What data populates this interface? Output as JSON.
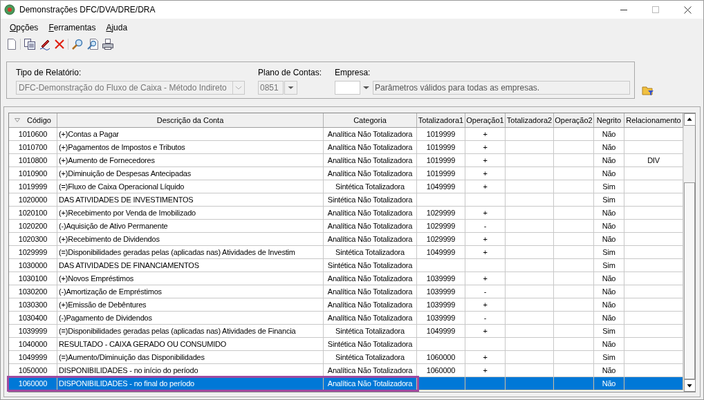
{
  "window": {
    "title": "Demonstrações DFC/DVA/DRE/DRA"
  },
  "menu": [
    "Opções",
    "Ferramentas",
    "Ajuda"
  ],
  "params": {
    "tipo": {
      "label": "Tipo de Relatório:",
      "value": "DFC-Demonstração do Fluxo de Caixa - Método Indireto",
      "disabled": true
    },
    "plano": {
      "label": "Plano de Contas:",
      "value": "0851",
      "disabled": true
    },
    "empresa": {
      "label": "Empresa:",
      "description": "Parâmetros válidos para todas as empresas."
    }
  },
  "table": {
    "columns": [
      "Código",
      "Descrição da Conta",
      "Categoria",
      "Totalizadora1",
      "Operação1",
      "Totalizadora2",
      "Operação2",
      "Negrito",
      "Relacionamento"
    ],
    "rows": [
      {
        "cells": [
          "1010600",
          "(+)Contas a Pagar",
          "Analítica Não Totalizadora",
          "1019999",
          "+",
          "",
          "",
          "Não",
          ""
        ],
        "selected": false
      },
      {
        "cells": [
          "1010700",
          "(+)Pagamentos de Impostos e Tributos",
          "Analítica Não Totalizadora",
          "1019999",
          "+",
          "",
          "",
          "Não",
          ""
        ],
        "selected": false
      },
      {
        "cells": [
          "1010800",
          "(+)Aumento de Fornecedores",
          "Analítica Não Totalizadora",
          "1019999",
          "+",
          "",
          "",
          "Não",
          "DIV"
        ],
        "selected": false
      },
      {
        "cells": [
          "1010900",
          "(+)Diminuição de Despesas Antecipadas",
          "Analítica Não Totalizadora",
          "1019999",
          "+",
          "",
          "",
          "Não",
          ""
        ],
        "selected": false
      },
      {
        "cells": [
          "1019999",
          "(=)Fluxo de Caixa Operacional Líquido",
          "Sintética Totalizadora",
          "1049999",
          "+",
          "",
          "",
          "Sim",
          ""
        ],
        "selected": false
      },
      {
        "cells": [
          "1020000",
          "DAS ATIVIDADES DE INVESTIMENTOS",
          "Sintética Não Totalizadora",
          "",
          "",
          "",
          "",
          "Sim",
          ""
        ],
        "selected": false
      },
      {
        "cells": [
          "1020100",
          "(+)Recebimento por Venda de Imobilizado",
          "Analítica Não Totalizadora",
          "1029999",
          "+",
          "",
          "",
          "Não",
          ""
        ],
        "selected": false
      },
      {
        "cells": [
          "1020200",
          "(-)Aquisição de Ativo Permanente",
          "Analítica Não Totalizadora",
          "1029999",
          "-",
          "",
          "",
          "Não",
          ""
        ],
        "selected": false
      },
      {
        "cells": [
          "1020300",
          "(+)Recebimento de Dividendos",
          "Analítica Não Totalizadora",
          "1029999",
          "+",
          "",
          "",
          "Não",
          ""
        ],
        "selected": false
      },
      {
        "cells": [
          "1029999",
          "(=)Disponibilidades geradas pelas (aplicadas nas) Atividades de Investim",
          "Sintética Totalizadora",
          "1049999",
          "+",
          "",
          "",
          "Sim",
          ""
        ],
        "selected": false
      },
      {
        "cells": [
          "1030000",
          "DAS ATIVIDADES DE FINANCIAMENTOS",
          "Sintética Não Totalizadora",
          "",
          "",
          "",
          "",
          "Sim",
          ""
        ],
        "selected": false
      },
      {
        "cells": [
          "1030100",
          "(+)Novos Empréstimos",
          "Analítica Não Totalizadora",
          "1039999",
          "+",
          "",
          "",
          "Não",
          ""
        ],
        "selected": false
      },
      {
        "cells": [
          "1030200",
          "(-)Amortização de Empréstimos",
          "Analítica Não Totalizadora",
          "1039999",
          "-",
          "",
          "",
          "Não",
          ""
        ],
        "selected": false
      },
      {
        "cells": [
          "1030300",
          "(+)Emissão de Debêntures",
          "Analítica Não Totalizadora",
          "1039999",
          "+",
          "",
          "",
          "Não",
          ""
        ],
        "selected": false
      },
      {
        "cells": [
          "1030400",
          "(-)Pagamento de Dividendos",
          "Analítica Não Totalizadora",
          "1039999",
          "-",
          "",
          "",
          "Não",
          ""
        ],
        "selected": false
      },
      {
        "cells": [
          "1039999",
          "(=)Disponibilidades geradas pelas (aplicadas nas) Atividades de Financia",
          "Sintética Totalizadora",
          "1049999",
          "+",
          "",
          "",
          "Sim",
          ""
        ],
        "selected": false
      },
      {
        "cells": [
          "1040000",
          "RESULTADO - CAIXA GERADO OU CONSUMIDO",
          "Sintética Não Totalizadora",
          "",
          "",
          "",
          "",
          "Não",
          ""
        ],
        "selected": false
      },
      {
        "cells": [
          "1049999",
          "(=)Aumento/Diminuição das Disponibilidades",
          "Sintética Totalizadora",
          "1060000",
          "+",
          "",
          "",
          "Sim",
          ""
        ],
        "selected": false
      },
      {
        "cells": [
          "1050000",
          "DISPONIBILIDADES - no início do período",
          "Analítica Não Totalizadora",
          "1060000",
          "+",
          "",
          "",
          "Não",
          ""
        ],
        "selected": false
      },
      {
        "cells": [
          "1060000",
          "DISPONIBILIDADES - no final do período",
          "Analítica Não Totalizadora",
          "",
          "",
          "",
          "",
          "Não",
          ""
        ],
        "selected": true,
        "outlined": true
      }
    ]
  }
}
